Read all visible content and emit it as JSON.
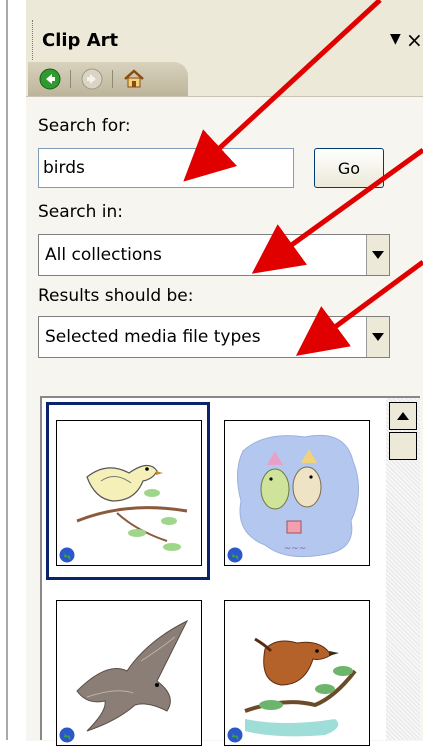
{
  "pane": {
    "title": "Clip Art",
    "dropdown_glyph": "▼",
    "close_glyph": "×"
  },
  "nav": {
    "back_icon": "back-arrow-icon",
    "forward_icon": "forward-arrow-icon",
    "home_icon": "home-icon"
  },
  "search_for": {
    "label": "Search for:",
    "value": "birds",
    "go_label": "Go"
  },
  "search_in": {
    "label": "Search in:",
    "value": "All collections"
  },
  "results_type": {
    "label": "Results should be:",
    "value": "Selected media file types"
  },
  "results": {
    "items": [
      {
        "name": "bird-on-branch-clip",
        "selected": true
      },
      {
        "name": "two-birds-party-clip",
        "selected": false
      },
      {
        "name": "eagle-flying-clip",
        "selected": false
      },
      {
        "name": "robin-on-branch-clip",
        "selected": false
      }
    ]
  },
  "colors": {
    "annotation_arrow": "#e00000",
    "selection": "#0a246a",
    "panel_bg": "#ece9d8"
  }
}
